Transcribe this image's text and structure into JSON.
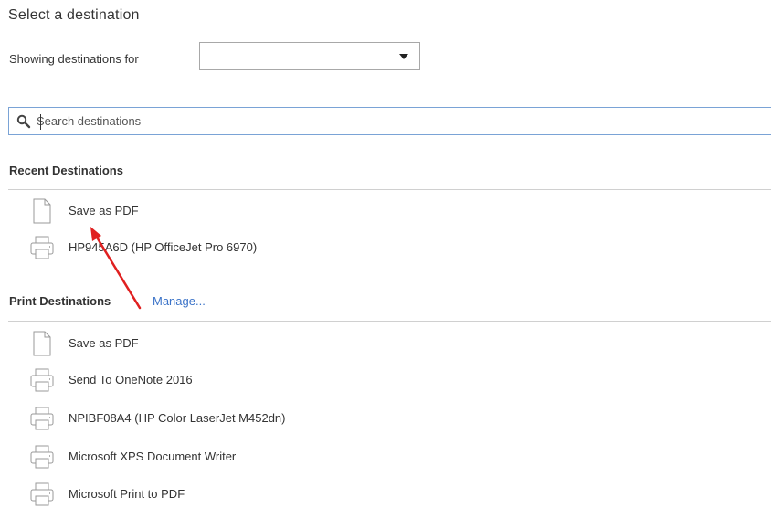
{
  "dialog": {
    "title": "Select a destination"
  },
  "filter": {
    "label": "Showing destinations for",
    "selected": ""
  },
  "search": {
    "placeholder": "Search destinations",
    "value": ""
  },
  "recent": {
    "heading": "Recent Destinations",
    "items": [
      {
        "label": "Save as PDF",
        "icon": "pdf-document-icon"
      },
      {
        "label": "HP945A6D (HP OfficeJet Pro 6970)",
        "icon": "printer-icon"
      }
    ]
  },
  "print": {
    "heading": "Print Destinations",
    "manage_label": "Manage...",
    "items": [
      {
        "label": "Save as PDF",
        "icon": "pdf-document-icon"
      },
      {
        "label": "Send To OneNote 2016",
        "icon": "printer-icon"
      },
      {
        "label": "NPIBF08A4 (HP Color LaserJet M452dn)",
        "icon": "printer-icon"
      },
      {
        "label": "Microsoft XPS Document Writer",
        "icon": "printer-icon"
      },
      {
        "label": "Microsoft Print to PDF",
        "icon": "printer-icon"
      }
    ]
  },
  "colors": {
    "link": "#3b73c8",
    "focus_border": "#7aa3d6",
    "annotation_arrow": "#e02020",
    "text": "#333333"
  }
}
